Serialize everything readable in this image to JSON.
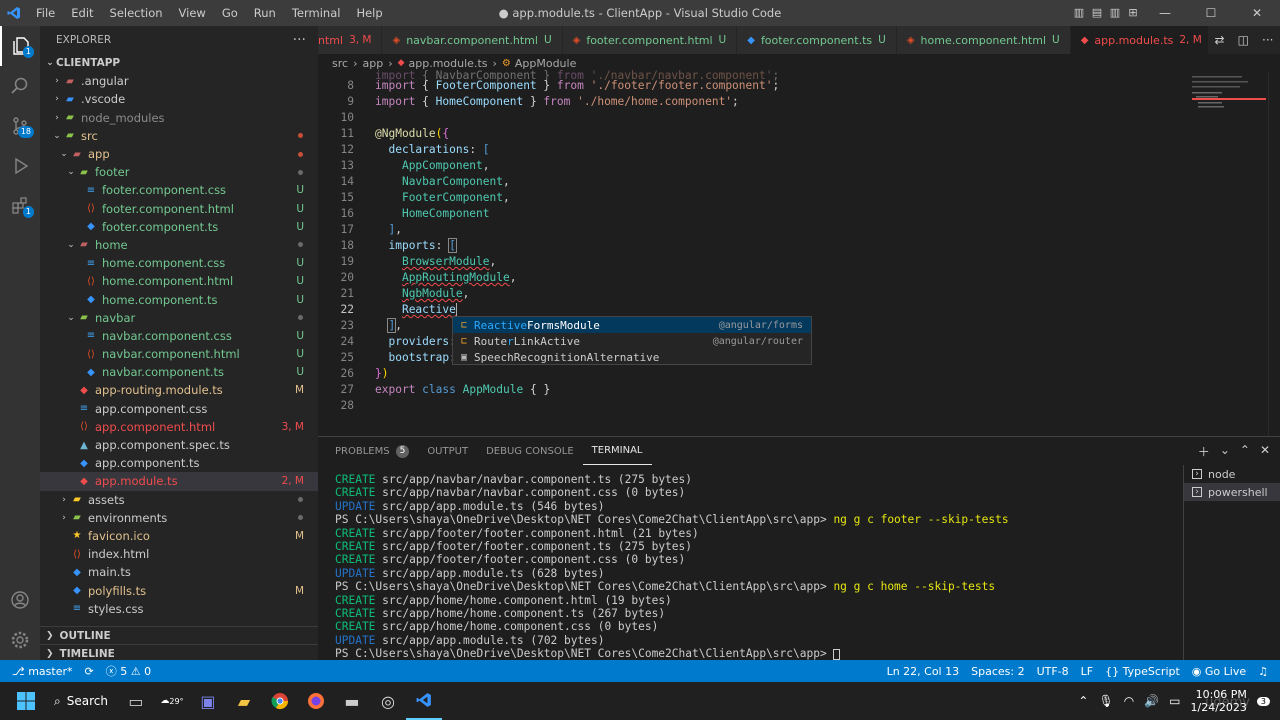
{
  "window": {
    "title": "● app.module.ts - ClientApp - Visual Studio Code",
    "menu": [
      "File",
      "Edit",
      "Selection",
      "View",
      "Go",
      "Run",
      "Terminal",
      "Help"
    ]
  },
  "activity": {
    "source_control_badge": "18",
    "extensions_badge": "1"
  },
  "explorer": {
    "header": "EXPLORER",
    "root": "CLIENTAPP",
    "items": [
      {
        "label": ".angular",
        "status": "",
        "color": "#cccccc"
      },
      {
        "label": ".vscode",
        "status": "",
        "color": "#cccccc"
      },
      {
        "label": "node_modules",
        "status": "",
        "color": "#8b8b8b"
      },
      {
        "label": "src",
        "status": "",
        "color": "#e2c08d"
      },
      {
        "label": "app",
        "status": "",
        "color": "#e2c08d"
      },
      {
        "label": "footer",
        "status": "",
        "color": "#73c991"
      },
      {
        "label": "footer.component.css",
        "status": "U",
        "color": "#73c991"
      },
      {
        "label": "footer.component.html",
        "status": "U",
        "color": "#73c991"
      },
      {
        "label": "footer.component.ts",
        "status": "U",
        "color": "#73c991"
      },
      {
        "label": "home",
        "status": "",
        "color": "#73c991"
      },
      {
        "label": "home.component.css",
        "status": "U",
        "color": "#73c991"
      },
      {
        "label": "home.component.html",
        "status": "U",
        "color": "#73c991"
      },
      {
        "label": "home.component.ts",
        "status": "U",
        "color": "#73c991"
      },
      {
        "label": "navbar",
        "status": "",
        "color": "#73c991"
      },
      {
        "label": "navbar.component.css",
        "status": "U",
        "color": "#73c991"
      },
      {
        "label": "navbar.component.html",
        "status": "U",
        "color": "#73c991"
      },
      {
        "label": "navbar.component.ts",
        "status": "U",
        "color": "#73c991"
      },
      {
        "label": "app-routing.module.ts",
        "status": "M",
        "color": "#e2c08d"
      },
      {
        "label": "app.component.css",
        "status": "",
        "color": "#cccccc"
      },
      {
        "label": "app.component.html",
        "status": "3, M",
        "color": "#f14c4c"
      },
      {
        "label": "app.component.spec.ts",
        "status": "",
        "color": "#cccccc"
      },
      {
        "label": "app.component.ts",
        "status": "",
        "color": "#cccccc"
      },
      {
        "label": "app.module.ts",
        "status": "2, M",
        "color": "#f14c4c"
      },
      {
        "label": "assets",
        "status": "",
        "color": "#cccccc"
      },
      {
        "label": "environments",
        "status": "",
        "color": "#cccccc"
      },
      {
        "label": "favicon.ico",
        "status": "M",
        "color": "#e2c08d"
      },
      {
        "label": "index.html",
        "status": "",
        "color": "#cccccc"
      },
      {
        "label": "main.ts",
        "status": "",
        "color": "#cccccc"
      },
      {
        "label": "polyfills.ts",
        "status": "M",
        "color": "#e2c08d"
      },
      {
        "label": "styles.css",
        "status": "",
        "color": "#cccccc"
      }
    ],
    "outline": "OUTLINE",
    "timeline": "TIMELINE"
  },
  "tabs": [
    {
      "label": "ntml",
      "status": "3, M",
      "active": false
    },
    {
      "label": "navbar.component.html",
      "status": "U",
      "active": false
    },
    {
      "label": "footer.component.html",
      "status": "U",
      "active": false
    },
    {
      "label": "footer.component.ts",
      "status": "U",
      "active": false
    },
    {
      "label": "home.component.html",
      "status": "U",
      "active": false
    },
    {
      "label": "app.module.ts",
      "status": "2, M",
      "active": true
    }
  ],
  "breadcrumb": [
    "src",
    "app",
    "app.module.ts",
    "AppModule"
  ],
  "editor": {
    "line_numbers": [
      "8",
      "9",
      "10",
      "11",
      "12",
      "13",
      "14",
      "15",
      "16",
      "17",
      "18",
      "19",
      "20",
      "21",
      "22",
      "23",
      "24",
      "25",
      "26",
      "27",
      "28"
    ],
    "current_line": "22"
  },
  "suggest": [
    {
      "prefix": "",
      "match": "Reactive",
      "rest": "FormsModule",
      "detail": "@angular/forms"
    },
    {
      "prefix": "Route",
      "match": "r",
      "rest": "LinkActive",
      "detail": "@angular/router"
    },
    {
      "prefix": "SpeechRecognitionAlternative",
      "match": "",
      "rest": "",
      "detail": ""
    }
  ],
  "panel": {
    "tabs": [
      "PROBLEMS",
      "OUTPUT",
      "DEBUG CONSOLE",
      "TERMINAL"
    ],
    "problems_count": "5",
    "terminal_lines": [
      {
        "type": "CREATE",
        "text": "src/app/navbar/navbar.component.ts (275 bytes)"
      },
      {
        "type": "CREATE",
        "text": "src/app/navbar/navbar.component.css (0 bytes)"
      },
      {
        "type": "UPDATE",
        "text": "src/app/app.module.ts (546 bytes)"
      },
      {
        "type": "PS",
        "text": "PS C:\\Users\\shaya\\OneDrive\\Desktop\\NET Cores\\Come2Chat\\ClientApp\\src\\app> ",
        "cmd": "ng g c footer --skip-tests"
      },
      {
        "type": "CREATE",
        "text": "src/app/footer/footer.component.html (21 bytes)"
      },
      {
        "type": "CREATE",
        "text": "src/app/footer/footer.component.ts (275 bytes)"
      },
      {
        "type": "CREATE",
        "text": "src/app/footer/footer.component.css (0 bytes)"
      },
      {
        "type": "UPDATE",
        "text": "src/app/app.module.ts (628 bytes)"
      },
      {
        "type": "PS",
        "text": "PS C:\\Users\\shaya\\OneDrive\\Desktop\\NET Cores\\Come2Chat\\ClientApp\\src\\app> ",
        "cmd": "ng g c home --skip-tests"
      },
      {
        "type": "CREATE",
        "text": "src/app/home/home.component.html (19 bytes)"
      },
      {
        "type": "CREATE",
        "text": "src/app/home/home.component.ts (267 bytes)"
      },
      {
        "type": "CREATE",
        "text": "src/app/home/home.component.css (0 bytes)"
      },
      {
        "type": "UPDATE",
        "text": "src/app/app.module.ts (702 bytes)"
      },
      {
        "type": "PS",
        "text": "PS C:\\Users\\shaya\\OneDrive\\Desktop\\NET Cores\\Come2Chat\\ClientApp\\src\\app> ",
        "cmd": ""
      }
    ],
    "terminals": [
      "node",
      "powershell"
    ]
  },
  "status": {
    "branch": "master*",
    "errors": "5",
    "warnings": "0",
    "position": "Ln 22, Col 13",
    "spaces": "Spaces: 2",
    "encoding": "UTF-8",
    "eol": "LF",
    "language": "TypeScript",
    "golive": "Go Live"
  },
  "taskbar": {
    "search": "Search",
    "weather": "29°",
    "time": "10:06 PM",
    "date": "1/24/2023",
    "watermark": "udemy"
  }
}
